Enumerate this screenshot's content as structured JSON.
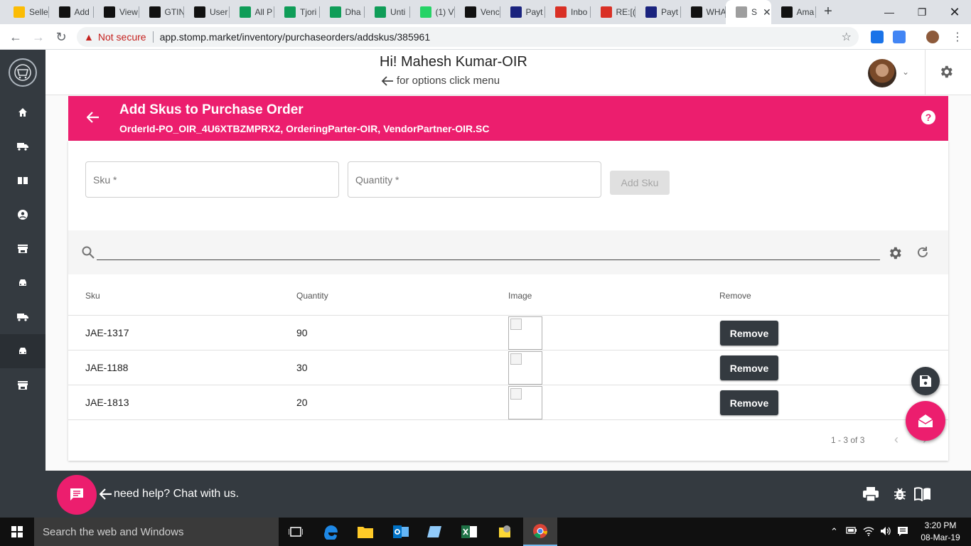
{
  "browser": {
    "tabs": [
      {
        "title": "Selle",
        "icon": "seller-icon",
        "color": "#fbbc04"
      },
      {
        "title": "Add",
        "icon": "amazon-icon",
        "color": "#111111"
      },
      {
        "title": "View",
        "icon": "amazon-icon",
        "color": "#111111"
      },
      {
        "title": "GTIN",
        "icon": "amazon-icon",
        "color": "#111111"
      },
      {
        "title": "User",
        "icon": "github-icon",
        "color": "#111111"
      },
      {
        "title": "All P",
        "icon": "sheets-icon",
        "color": "#0f9d58"
      },
      {
        "title": "Tjori",
        "icon": "sheets-icon",
        "color": "#0f9d58"
      },
      {
        "title": "Dha",
        "icon": "sheets-icon",
        "color": "#0f9d58"
      },
      {
        "title": "Unti",
        "icon": "sheets-icon",
        "color": "#0f9d58"
      },
      {
        "title": "(1) V",
        "icon": "whatsapp-icon",
        "color": "#25d366"
      },
      {
        "title": "Venc",
        "icon": "amazon-icon",
        "color": "#111111"
      },
      {
        "title": "Payt",
        "icon": "paytm-icon",
        "color": "#1a237e"
      },
      {
        "title": "Inbo",
        "icon": "gmail-icon",
        "color": "#d93025"
      },
      {
        "title": "RE:[(",
        "icon": "gmail-icon",
        "color": "#d93025"
      },
      {
        "title": "Payt",
        "icon": "paytm-icon",
        "color": "#1a237e"
      },
      {
        "title": "WHA",
        "icon": "amazon-icon",
        "color": "#111111"
      },
      {
        "title": "S",
        "icon": "stomp-icon",
        "color": "#9e9e9e",
        "active": true
      },
      {
        "title": "Ama",
        "icon": "amazon-icon",
        "color": "#111111"
      }
    ],
    "security_label": "Not secure",
    "url": "app.stomp.market/inventory/purchaseorders/addskus/385961"
  },
  "header": {
    "greeting": "Hi! Mahesh Kumar-OIR",
    "hint": "for options click menu"
  },
  "banner": {
    "title": "Add Skus to Purchase Order",
    "subtitle": "OrderId-PO_OIR_4U6XTBZMPRX2, OrderingParter-OIR, VendorPartner-OIR.SC",
    "color": "#ec1e6e"
  },
  "form": {
    "sku_placeholder": "Sku *",
    "quantity_placeholder": "Quantity *",
    "add_button": "Add Sku"
  },
  "table": {
    "columns": [
      "Sku",
      "Quantity",
      "Image",
      "Remove"
    ],
    "rows": [
      {
        "sku": "JAE-1317",
        "quantity": "90",
        "action": "Remove"
      },
      {
        "sku": "JAE-1188",
        "quantity": "30",
        "action": "Remove"
      },
      {
        "sku": "JAE-1813",
        "quantity": "20",
        "action": "Remove"
      }
    ],
    "pagination": "1 - 3 of 3"
  },
  "footer": {
    "chat_text": "need help? Chat with us."
  },
  "taskbar": {
    "search_placeholder": "Search the web and Windows",
    "time": "3:20 PM",
    "date": "08-Mar-19"
  }
}
